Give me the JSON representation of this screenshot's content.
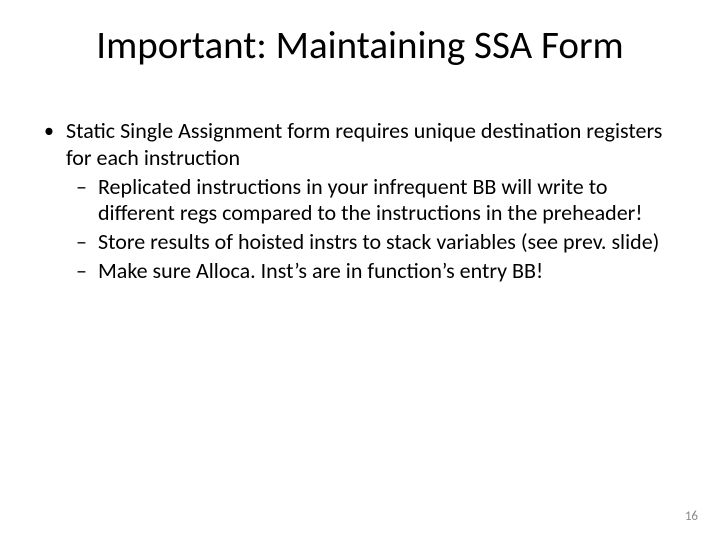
{
  "slide": {
    "title": "Important: Maintaining SSA Form",
    "bullets": [
      {
        "text": "Static Single Assignment form requires unique destination registers for each instruction",
        "sub": [
          "Replicated instructions in your infrequent  BB will write to different regs compared to the instructions in the preheader!",
          "Store results of hoisted instrs to stack variables (see prev. slide)",
          "Make sure Alloca. Inst’s are in function’s entry BB!"
        ]
      }
    ],
    "page_number": "16"
  }
}
